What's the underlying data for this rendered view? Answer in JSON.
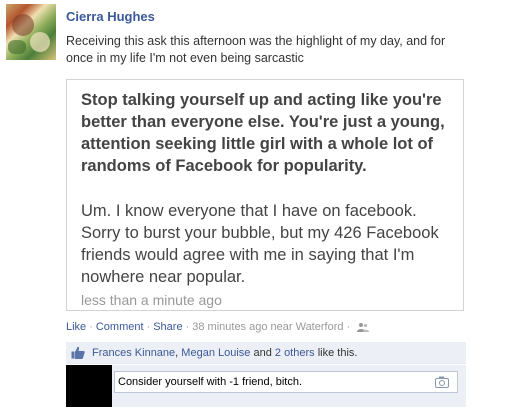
{
  "post": {
    "author": "Cierra Hughes",
    "status_text": "Receiving this ask this afternoon was the highlight of my day, and for once in my life I'm not even being sarcastic",
    "ask": {
      "question": "Stop talking yourself up and acting like you're better than everyone else. You're just a young, attention seeking little girl with a whole lot of randoms of Facebook for popularity.",
      "answer": "Um. I know everyone that I have on facebook. Sorry to burst your bubble, but my 426 Facebook friends would agree with me in saying that I'm nowhere near popular.",
      "time_ago": "less than a minute ago"
    },
    "actions": {
      "like": "Like",
      "comment": "Comment",
      "share": "Share",
      "time": "38 minutes ago near Waterford",
      "audience_icon": "friends-icon"
    },
    "likes": {
      "name1": "Frances Kinnane",
      "name2": "Megan Louise",
      "and": "and",
      "others": "2 others",
      "suffix": "like this."
    },
    "comment": {
      "value": "Consider yourself with -1 friend, bitch.",
      "attach_icon": "camera-icon"
    }
  },
  "colors": {
    "link": "#3b5998",
    "meta": "#999999",
    "like_bar_bg": "#eceff5"
  }
}
